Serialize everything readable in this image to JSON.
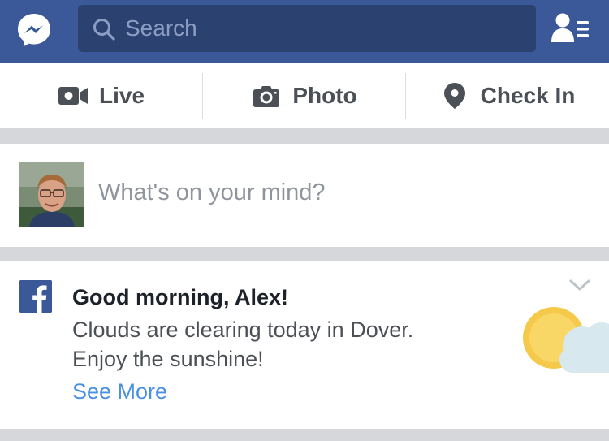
{
  "navbar": {
    "search_placeholder": "Search",
    "icons": [
      "messenger-icon",
      "search-icon",
      "friend-requests-icon"
    ],
    "bg_color": "#3b5998"
  },
  "actions": [
    {
      "label": "Live",
      "icon": "video-camera-icon"
    },
    {
      "label": "Photo",
      "icon": "camera-icon"
    },
    {
      "label": "Check In",
      "icon": "location-pin-icon"
    }
  ],
  "composer": {
    "prompt": "What's on your mind?"
  },
  "greeting": {
    "title": "Good morning, Alex!",
    "line1": "Clouds are clearing today in Dover.",
    "line2": "Enjoy the sunshine!",
    "link": "See More",
    "link_color": "#4a90e2",
    "weather_icon": "partly-cloudy-icon"
  }
}
